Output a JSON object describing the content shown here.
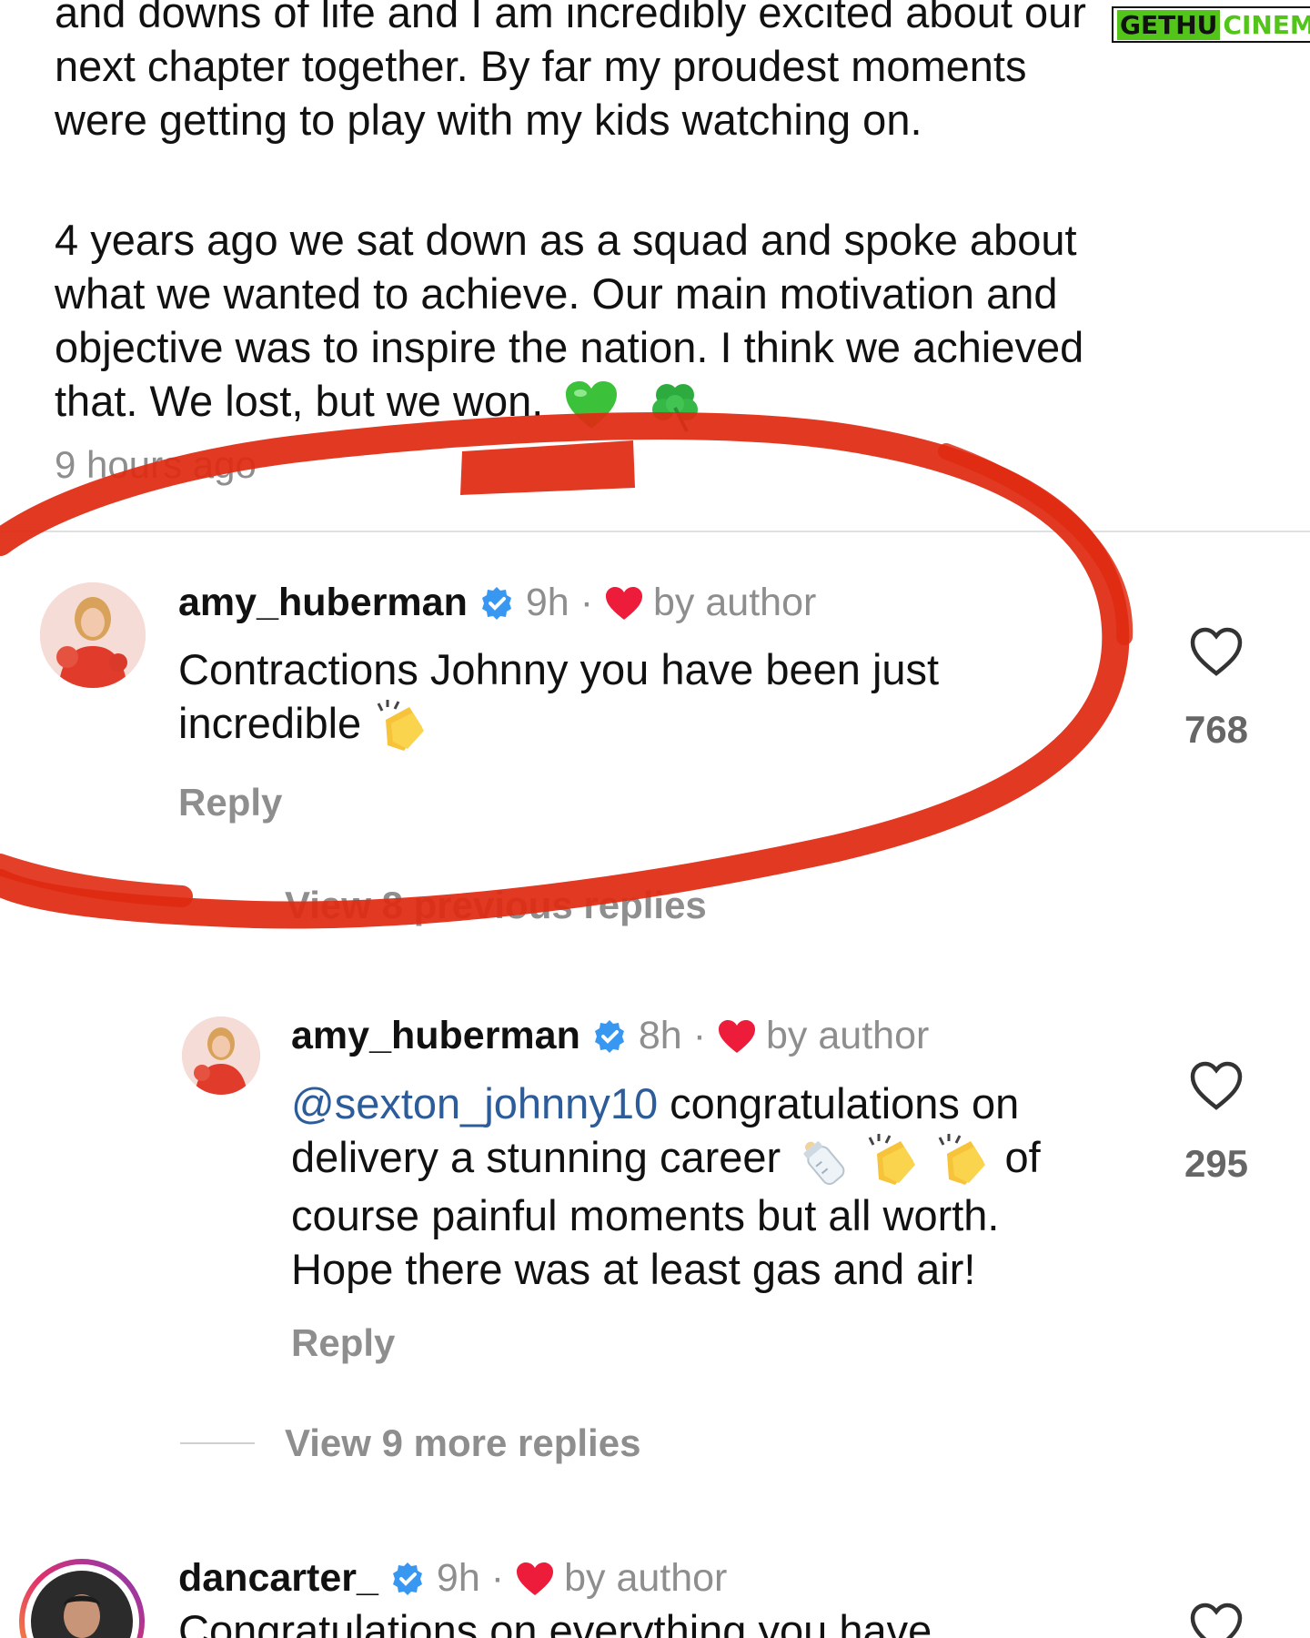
{
  "caption": {
    "line1": "and downs of life and I am incredibly excited about our",
    "line2": "next chapter together. By far my proudest moments",
    "line3": "were getting to play with my kids watching on.",
    "para2_line1": "4 years ago we sat down as a squad and spoke about",
    "para2_line2": "what we wanted to achieve. Our main motivation and",
    "para2_line3": "objective was to inspire the nation. I think we achieved",
    "para2_line4": "that. We lost, but we won."
  },
  "post_timestamp": "9 hours ago",
  "watermark": {
    "part1": "GETHU",
    "part2": "CINEMA"
  },
  "comments": [
    {
      "username": "amy_huberman",
      "time": "9h",
      "badge": "by author",
      "text_line1": "Contractions Johnny you have been just",
      "text_line2": "incredible",
      "reply_label": "Reply",
      "likes": "768"
    },
    {
      "username": "amy_huberman",
      "time": "8h",
      "badge": "by author",
      "mention": "@sexton_johnny10",
      "text_line1_rest": " congratulations on",
      "text_line2_start": "delivery a stunning career",
      "text_line2_end": "of",
      "text_line3": "course painful moments but all worth.",
      "text_line4": "Hope there was at least gas and air!",
      "reply_label": "Reply",
      "likes": "295"
    },
    {
      "username": "dancarter_",
      "time": "9h",
      "badge": "by author",
      "text_line1": "Congratulations on everything you have"
    }
  ],
  "view_previous": "View 8 previous replies",
  "view_more": "View 9 more replies",
  "colors": {
    "highlight": "#e02a12",
    "mention": "#2c5c9a",
    "verified": "#3897f0",
    "heart": "#ed1c3a"
  },
  "icons": [
    "verified-badge-icon",
    "red-heart-icon",
    "heart-outline-icon",
    "clapping-hands-icon",
    "baby-bottle-icon",
    "green-heart-icon",
    "shamrock-icon"
  ]
}
